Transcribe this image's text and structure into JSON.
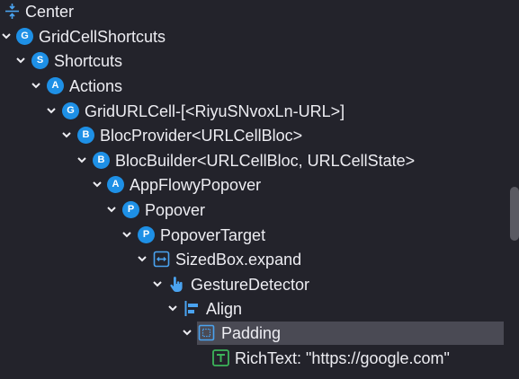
{
  "nodes": [
    {
      "label": "Center",
      "icon": "center-align-icon"
    },
    {
      "label": "GridCellShortcuts",
      "badge": "G"
    },
    {
      "label": "Shortcuts",
      "badge": "S"
    },
    {
      "label": "Actions",
      "badge": "A"
    },
    {
      "label": "GridURLCell-[<RiyuSNvoxLn-URL>]",
      "badge": "G"
    },
    {
      "label": "BlocProvider<URLCellBloc>",
      "badge": "B"
    },
    {
      "label": "BlocBuilder<URLCellBloc, URLCellState>",
      "badge": "B"
    },
    {
      "label": "AppFlowyPopover",
      "badge": "A"
    },
    {
      "label": "Popover",
      "badge": "P"
    },
    {
      "label": "PopoverTarget",
      "badge": "P"
    },
    {
      "label": "SizedBox.expand",
      "icon": "sized-box-icon"
    },
    {
      "label": "GestureDetector",
      "icon": "gesture-hand-icon"
    },
    {
      "label": "Align",
      "icon": "align-left-icon"
    },
    {
      "label": "Padding",
      "icon": "padding-icon",
      "selected": true
    },
    {
      "label": "RichText: \"https://google.com\"",
      "icon": "text-t-icon"
    }
  ],
  "colors": {
    "background": "#23232b",
    "badge": "#1e90e6",
    "selected_row": "#4a4a54",
    "text_icon_green": "#3cb45a"
  }
}
